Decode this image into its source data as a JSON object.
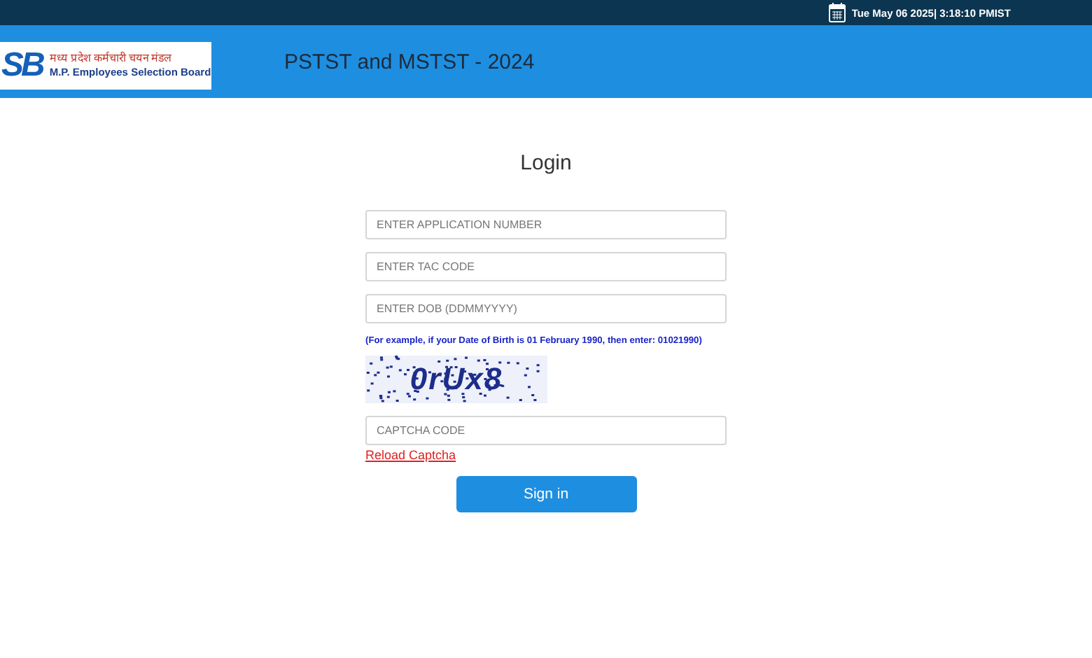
{
  "top_bar": {
    "datetime": "Tue May 06 2025| 3:18:10 PMIST"
  },
  "header": {
    "logo": {
      "mark": "SB",
      "hindi": "मध्य प्रदेश कर्मचारी चयन मंडल",
      "english": "M.P. Employees Selection Board"
    },
    "title": "PSTST and MSTST - 2024"
  },
  "login": {
    "title": "Login",
    "fields": [
      {
        "placeholder": "ENTER APPLICATION NUMBER"
      },
      {
        "placeholder": "ENTER TAC CODE"
      },
      {
        "placeholder": "ENTER DOB (DDMMYYYY)"
      }
    ],
    "hint": "(For example, if your Date of Birth is 01 February 1990, then enter: 01021990)",
    "captcha": {
      "text": "0rUx8"
    },
    "captcha_field": {
      "placeholder": "CAPTCHA CODE"
    },
    "reload_link": "Reload Captcha",
    "button": "Sign in"
  }
}
